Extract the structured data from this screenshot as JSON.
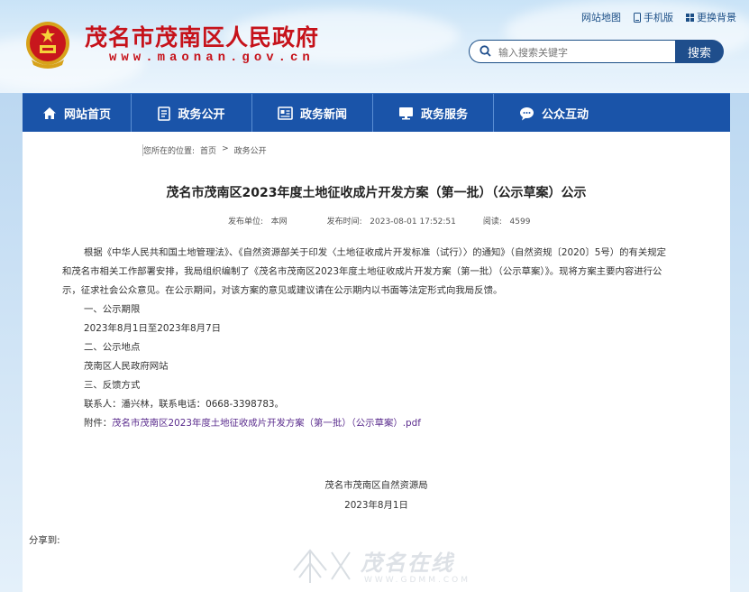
{
  "header": {
    "site_title": "茂名市茂南区人民政府",
    "site_url": "www.maonan.gov.cn",
    "top_links": [
      "网站地图",
      "手机版",
      "更换背景"
    ],
    "search": {
      "placeholder": "输入搜索关键字",
      "button_label": "搜索"
    }
  },
  "nav": {
    "items": [
      {
        "label": "网站首页",
        "icon": "home-icon"
      },
      {
        "label": "政务公开",
        "icon": "document-icon"
      },
      {
        "label": "政务新闻",
        "icon": "news-icon"
      },
      {
        "label": "政务服务",
        "icon": "monitor-icon"
      },
      {
        "label": "公众互动",
        "icon": "chat-icon"
      }
    ]
  },
  "breadcrumb": {
    "prefix": "您所在的位置:",
    "items": [
      "首页",
      "政务公开"
    ],
    "separator": ">"
  },
  "article": {
    "title": "茂名市茂南区2023年度土地征收成片开发方案（第一批）（公示草案）公示",
    "meta": {
      "publisher_label": "发布单位:",
      "publisher": "本网",
      "time_label": "发布时间:",
      "time": "2023-08-01 17:52:51",
      "views_label": "阅读:",
      "views": "4599"
    },
    "paragraphs": [
      "根据《中华人民共和国土地管理法》、《自然资源部关于印发〈土地征收成片开发标准（试行）〉的通知》（自然资规〔2020〕5号）的有关规定",
      "和茂名市相关工作部署安排，我局组织编制了《茂名市茂南区2023年度土地征收成片开发方案（第一批）（公示草案）》。现将方案主要内容进行公",
      "示，征求社会公众意见。在公示期间，对该方案的意见或建议请在公示期内以书面等法定形式向我局反馈。",
      "一、公示期限",
      "2023年8月1日至2023年8月7日",
      "二、公示地点",
      "茂南区人民政府网站",
      "三、反馈方式",
      "联系人：潘兴林，联系电话：0668-3398783。"
    ],
    "attachment_label": "附件：",
    "attachment_name": "茂名市茂南区2023年度土地征收成片开发方案（第一批）（公示草案）.pdf",
    "signature_org": "茂名市茂南区自然资源局",
    "signature_date": "2023年8月1日",
    "share_label": "分享到:"
  },
  "watermark": {
    "text": "茂名在线",
    "url": "WWW.GDMM.COM"
  },
  "colors": {
    "nav_blue": "#1a54a9",
    "title_red": "#c6121a",
    "attach_purple": "#5b2d8e"
  }
}
